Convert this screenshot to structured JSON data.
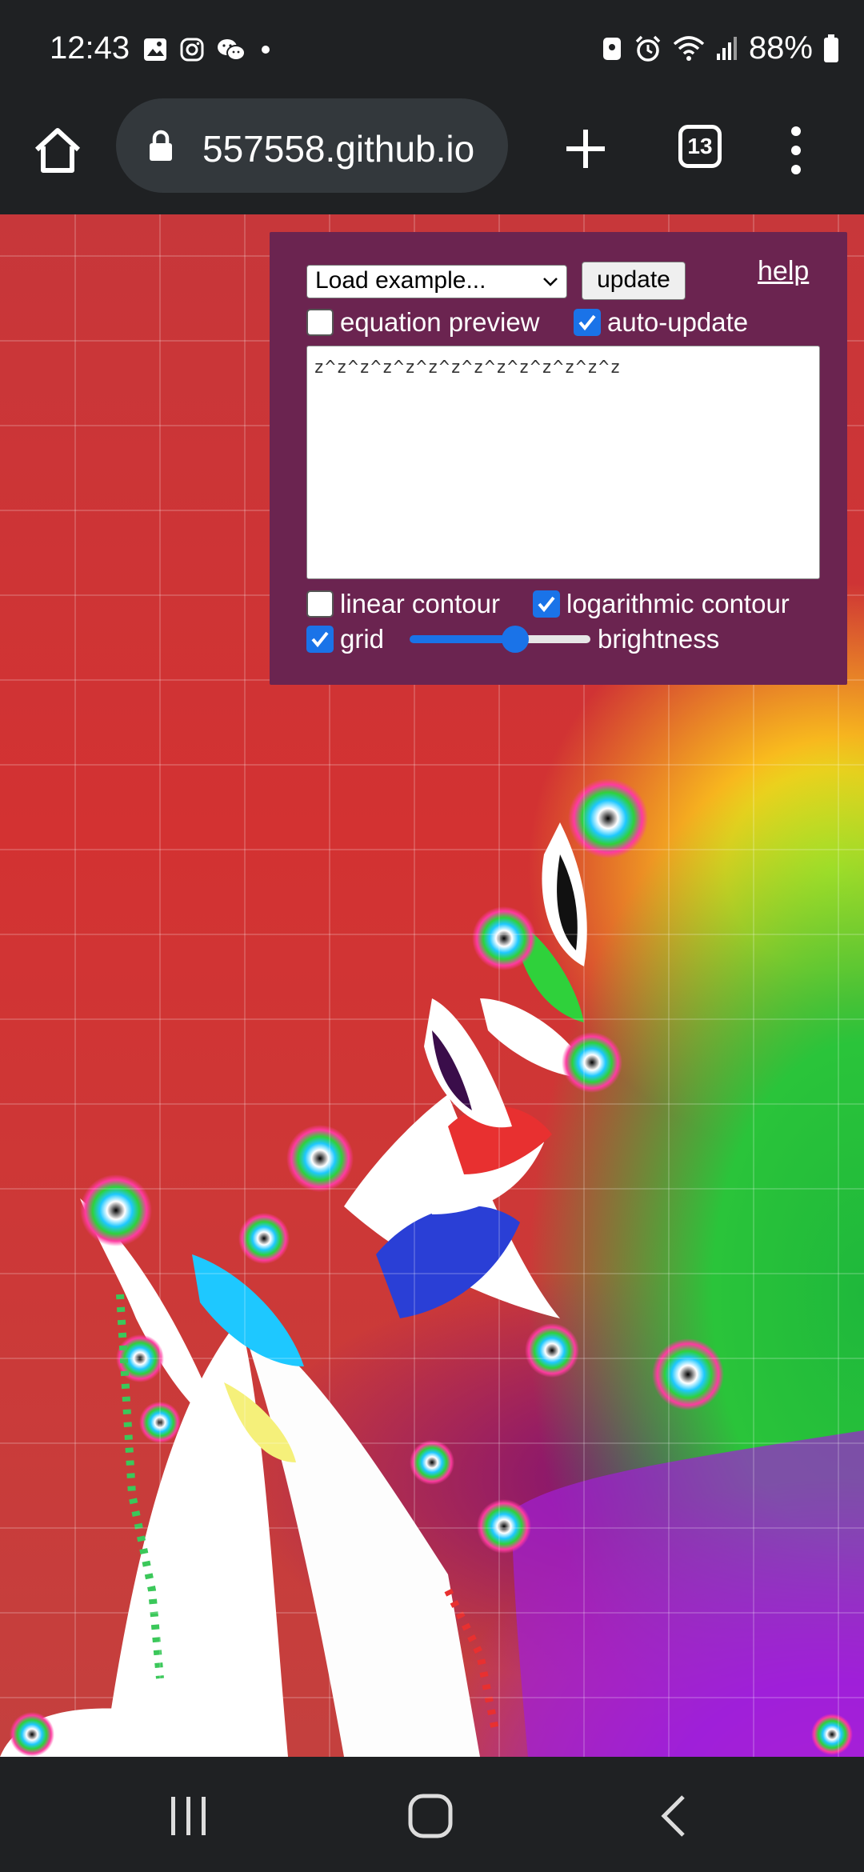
{
  "status_bar": {
    "time": "12:43",
    "battery": "88%",
    "left_icons": [
      "gallery-icon",
      "instagram-icon",
      "wechat-icon",
      "dot-icon"
    ],
    "right_icons": [
      "notification-icon",
      "alarm-icon",
      "wifi-icon",
      "signal-icon",
      "battery-icon"
    ]
  },
  "browser": {
    "url": "557558.github.io",
    "tab_count": "13",
    "icons": [
      "home-icon",
      "lock-icon",
      "plus-icon",
      "tabs-icon",
      "menu-icon"
    ]
  },
  "panel": {
    "example_select": "Load example...",
    "update_button": "update",
    "help_link": "help",
    "equation_preview": {
      "label": "equation preview",
      "checked": false
    },
    "auto_update": {
      "label": "auto-update",
      "checked": true
    },
    "equation": "z^z^z^z^z^z^z^z^z^z^z^z^z^z",
    "linear_contour": {
      "label": "linear contour",
      "checked": false
    },
    "logarithmic_contour": {
      "label": "logarithmic contour",
      "checked": true
    },
    "grid": {
      "label": "grid",
      "checked": true
    },
    "brightness": {
      "label": "brightness",
      "value": 0.6
    }
  },
  "nav_bar": {
    "icons": [
      "recent-apps-icon",
      "home-nav-icon",
      "back-icon"
    ]
  },
  "colors": {
    "chrome_bg": "#1f2123",
    "url_bar_bg": "#33383c",
    "panel_bg": "#6b2450",
    "accent": "#1a73e8"
  }
}
